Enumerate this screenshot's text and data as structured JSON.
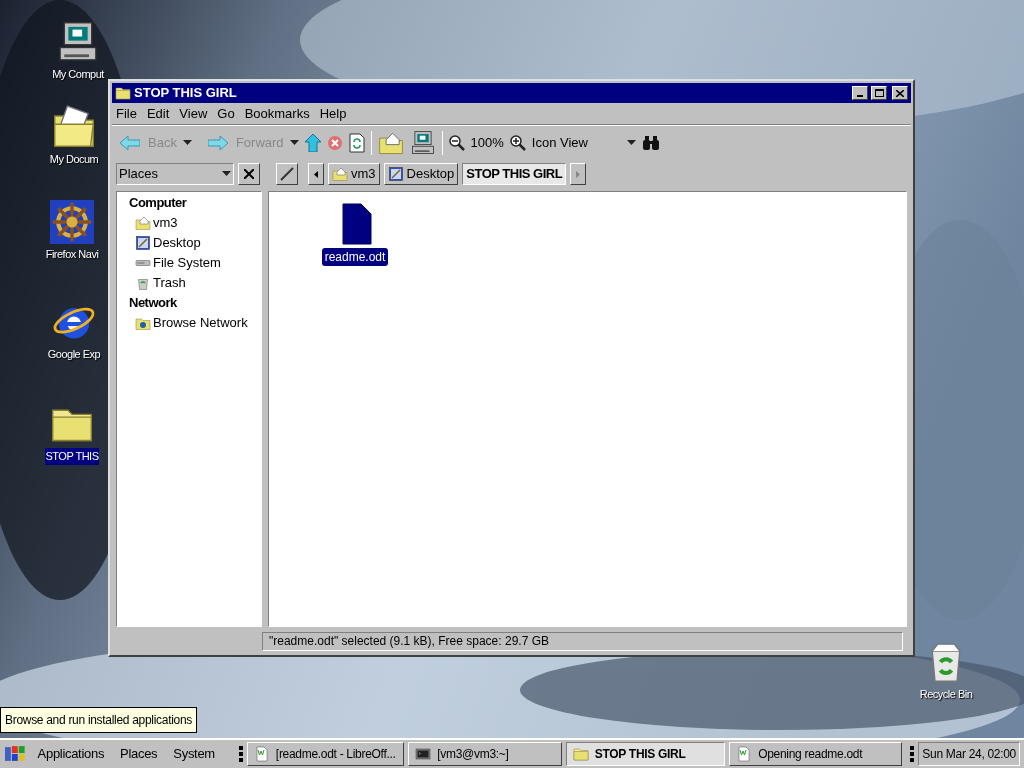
{
  "desktop_icons": [
    {
      "label": "My Comput",
      "kind": "computer",
      "selected": false
    },
    {
      "label": "My Docum",
      "kind": "documents",
      "selected": false
    },
    {
      "label": "Firefox Navi",
      "kind": "wheel",
      "selected": false
    },
    {
      "label": "Google Exp",
      "kind": "globe",
      "selected": false
    },
    {
      "label": "STOP THIS",
      "kind": "folder",
      "selected": true
    },
    {
      "label": "Recycle Bin",
      "kind": "recycle",
      "selected": false
    }
  ],
  "window": {
    "title": "STOP THIS GIRL",
    "menu": [
      "File",
      "Edit",
      "View",
      "Go",
      "Bookmarks",
      "Help"
    ],
    "toolbar": {
      "back": {
        "label": "Back",
        "disabled": true
      },
      "forward": {
        "label": "Forward",
        "disabled": true
      },
      "zoom": "100%",
      "view": "Icon View"
    },
    "sidebar": {
      "selector": "Places",
      "sections": [
        {
          "title": "Computer",
          "items": [
            {
              "label": "vm3",
              "kind": "home"
            },
            {
              "label": "Desktop",
              "kind": "desktop"
            },
            {
              "label": "File System",
              "kind": "drive"
            },
            {
              "label": "Trash",
              "kind": "trash"
            }
          ]
        },
        {
          "title": "Network",
          "items": [
            {
              "label": "Browse Network",
              "kind": "network"
            }
          ]
        }
      ]
    },
    "path_bar": [
      {
        "label": "vm3",
        "kind": "home",
        "selected": false
      },
      {
        "label": "Desktop",
        "kind": "desktop",
        "selected": false
      },
      {
        "label": "STOP THIS GIRL",
        "kind": "none",
        "selected": true
      }
    ],
    "files": [
      {
        "name": "readme.odt",
        "selected": true
      }
    ],
    "status_bar": "\"readme.odt\" selected (9.1 kB), Free space: 29.7 GB"
  },
  "tooltip": "Browse and run installed applications",
  "taskbar": {
    "menus": [
      "Applications",
      "Places",
      "System"
    ],
    "tasks": [
      {
        "label": "[readme.odt - LibreOff...",
        "kind": "writer",
        "selected": false
      },
      {
        "label": "[vm3@vm3:~]",
        "kind": "terminal",
        "selected": false
      },
      {
        "label": "STOP THIS GIRL",
        "kind": "folder",
        "selected": true
      },
      {
        "label": "Opening readme.odt",
        "kind": "writer",
        "selected": false
      }
    ],
    "clock": "Sun Mar 24, 02:00"
  }
}
